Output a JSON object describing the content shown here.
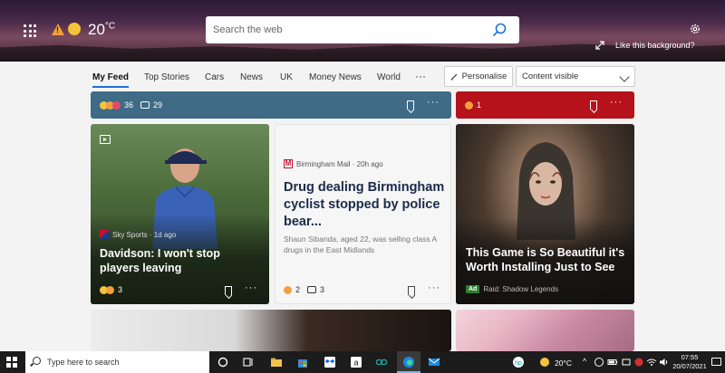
{
  "header": {
    "temperature": "20",
    "temp_unit": "°C",
    "search_placeholder": "Search the web",
    "like_background": "Like this background?"
  },
  "nav": {
    "tabs": [
      "My Feed",
      "Top Stories",
      "Cars",
      "News",
      "UK",
      "Money News",
      "World"
    ],
    "active_tab": "My Feed",
    "more": "···",
    "personalise_label": "Personalise",
    "content_select_value": "Content visible"
  },
  "cards": {
    "top_left": {
      "reaction_count": "36",
      "comment_count": "29"
    },
    "top_right": {
      "reaction_count": "1"
    },
    "davidson": {
      "source": "Sky Sports · 1d ago",
      "title": "Davidson: I won't stop players leaving",
      "reaction_count": "3"
    },
    "drug": {
      "source": "Birmingham Mail · 20h ago",
      "title": "Drug dealing Birmingham cyclist stopped by police bear...",
      "summary": "Shaun Sibanda, aged 22, was selling class A drugs in the East Midlands",
      "reaction_count": "2",
      "comment_count": "3"
    },
    "raid": {
      "title": "This Game is So Beautiful it's Worth Installing Just to See",
      "ad_label": "Ad",
      "advertiser": "Raid: Shadow Legends"
    }
  },
  "taskbar": {
    "search_placeholder": "Type here to search",
    "weather_temp": "20°C",
    "time": "07:55",
    "date": "20/07/2021"
  },
  "colors": {
    "accent": "#1a73d8",
    "topbar_left": "#3f6b86",
    "topbar_right": "#b5121b",
    "ad_green": "#2e7d32"
  }
}
